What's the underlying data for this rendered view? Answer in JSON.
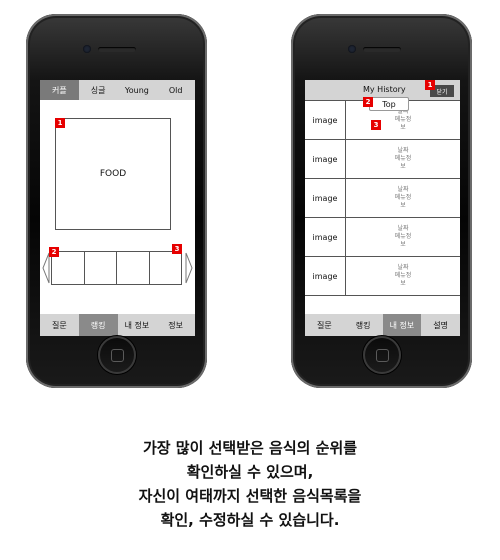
{
  "left_phone": {
    "tabs": [
      {
        "label": "커플",
        "active": true
      },
      {
        "label": "싱글",
        "active": false
      },
      {
        "label": "Young",
        "active": false
      },
      {
        "label": "Old",
        "active": false
      }
    ],
    "food_label": "FOOD",
    "badges": [
      "1",
      "2",
      "3"
    ],
    "bottom_nav": [
      {
        "label": "질문",
        "active": false
      },
      {
        "label": "랭킹",
        "active": true
      },
      {
        "label": "내 정보",
        "active": false
      },
      {
        "label": "정보",
        "active": false
      }
    ]
  },
  "right_phone": {
    "title": "My History",
    "close_label": "닫기",
    "top_label": "Top",
    "badges": [
      "1",
      "2",
      "3"
    ],
    "rows": [
      {
        "image": "image",
        "info": [
          "날짜",
          "메뉴정",
          "보"
        ]
      },
      {
        "image": "image",
        "info": [
          "날짜",
          "메뉴정",
          "보"
        ]
      },
      {
        "image": "image",
        "info": [
          "날짜",
          "메뉴정",
          "보"
        ]
      },
      {
        "image": "image",
        "info": [
          "날짜",
          "메뉴정",
          "보"
        ]
      },
      {
        "image": "image",
        "info": [
          "날짜",
          "메뉴정",
          "보"
        ]
      }
    ],
    "bottom_nav": [
      {
        "label": "질문",
        "active": false
      },
      {
        "label": "랭킹",
        "active": false
      },
      {
        "label": "내 정보",
        "active": true
      },
      {
        "label": "설명",
        "active": false
      }
    ]
  },
  "caption": [
    "가장 많이 선택받은 음식의 순위를",
    "확인하실 수 있으며,",
    "자신이 여태까지 선택한 음식목록을",
    "확인, 수정하실 수 있습니다."
  ]
}
